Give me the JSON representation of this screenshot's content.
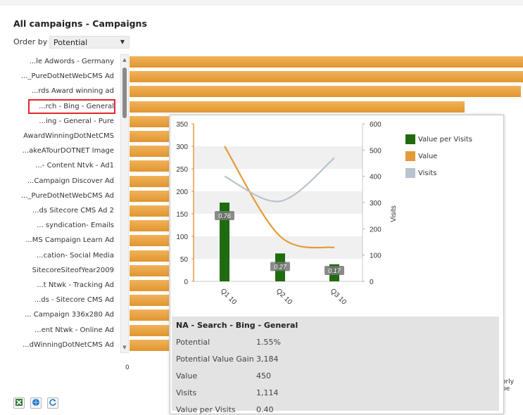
{
  "page": {
    "title": "All campaigns - Campaigns",
    "order_by_label": "Order by",
    "order_by_value": "Potential",
    "axis_zero": "0",
    "background_text": "orly pe"
  },
  "categories": [
    {
      "label": "...le Adwords - Germany",
      "value": 1.0
    },
    {
      "label": "..._PureDotNetWebCMS Ad",
      "value": 1.0
    },
    {
      "label": "...rds Award winning ad",
      "value": 0.995
    },
    {
      "label": "...rch - Bing - General",
      "value": 0.852
    },
    {
      "label": "...ing - General - Pure",
      "value": 0.1
    },
    {
      "label": "AwardWinningDotNetCMS",
      "value": 0.1
    },
    {
      "label": "...akeATourDOTNET Image",
      "value": 0.1
    },
    {
      "label": "...- Content Ntvk - Ad1",
      "value": 0.1
    },
    {
      "label": "...Campaign Discover Ad",
      "value": 0.1
    },
    {
      "label": "..._PureDotNetWebCMS Ad",
      "value": 0.1
    },
    {
      "label": "...ds Sitecore CMS Ad 2",
      "value": 0.1
    },
    {
      "label": "... syndication- Emails",
      "value": 0.1
    },
    {
      "label": "...MS Campaign Learn Ad",
      "value": 0.1
    },
    {
      "label": "...cation- Social Media",
      "value": 0.1
    },
    {
      "label": "SitecoreSiteofYear2009",
      "value": 0.1
    },
    {
      "label": "...t Ntwk - Tracking Ad",
      "value": 0.1
    },
    {
      "label": "...ds - Sitecore CMS Ad",
      "value": 0.1
    },
    {
      "label": "... Campaign 336x280 Ad",
      "value": 0.1
    },
    {
      "label": "...ent Ntwk - Online Ad",
      "value": 0.1
    },
    {
      "label": "...dWinningDotNetCMS Ad",
      "value": 0.1
    }
  ],
  "selected_index": 3,
  "chart_data": {
    "type": "bar",
    "categories": [
      "Q1 10",
      "Q2 10",
      "Q3 10"
    ],
    "series": [
      {
        "name": "Value per Visits",
        "type": "bar",
        "axis": "left",
        "values": [
          175,
          62,
          38
        ],
        "labels": [
          "0.76",
          "0.27",
          "0.17"
        ]
      },
      {
        "name": "Value",
        "type": "line",
        "axis": "left",
        "values": [
          300,
          100,
          75
        ]
      },
      {
        "name": "Visits",
        "type": "line",
        "axis": "right",
        "values": [
          400,
          305,
          470
        ]
      }
    ],
    "left_axis": {
      "min": 0,
      "max": 350,
      "ticks": [
        "0",
        "50",
        "100",
        "150",
        "200",
        "250",
        "300",
        "350"
      ]
    },
    "right_axis": {
      "label": "Visits",
      "min": 0,
      "max": 600,
      "ticks": [
        "0",
        "100",
        "200",
        "300",
        "400",
        "500",
        "600"
      ]
    },
    "legend_position": "right",
    "colors": {
      "Value per Visits": "#1f6b10",
      "Value": "#e49a38",
      "Visits": "#b9c3cc"
    }
  },
  "details": {
    "name": "NA - Search - Bing - General",
    "rows": [
      {
        "key": "Potential",
        "value": "1.55%"
      },
      {
        "key": "Potential Value Gain",
        "value": "3,184"
      },
      {
        "key": "Value",
        "value": "450"
      },
      {
        "key": "Visits",
        "value": "1,114"
      },
      {
        "key": "Value per Visits",
        "value": "0.40"
      }
    ]
  },
  "icons": [
    "excel-export-icon",
    "globe-icon",
    "refresh-icon"
  ]
}
